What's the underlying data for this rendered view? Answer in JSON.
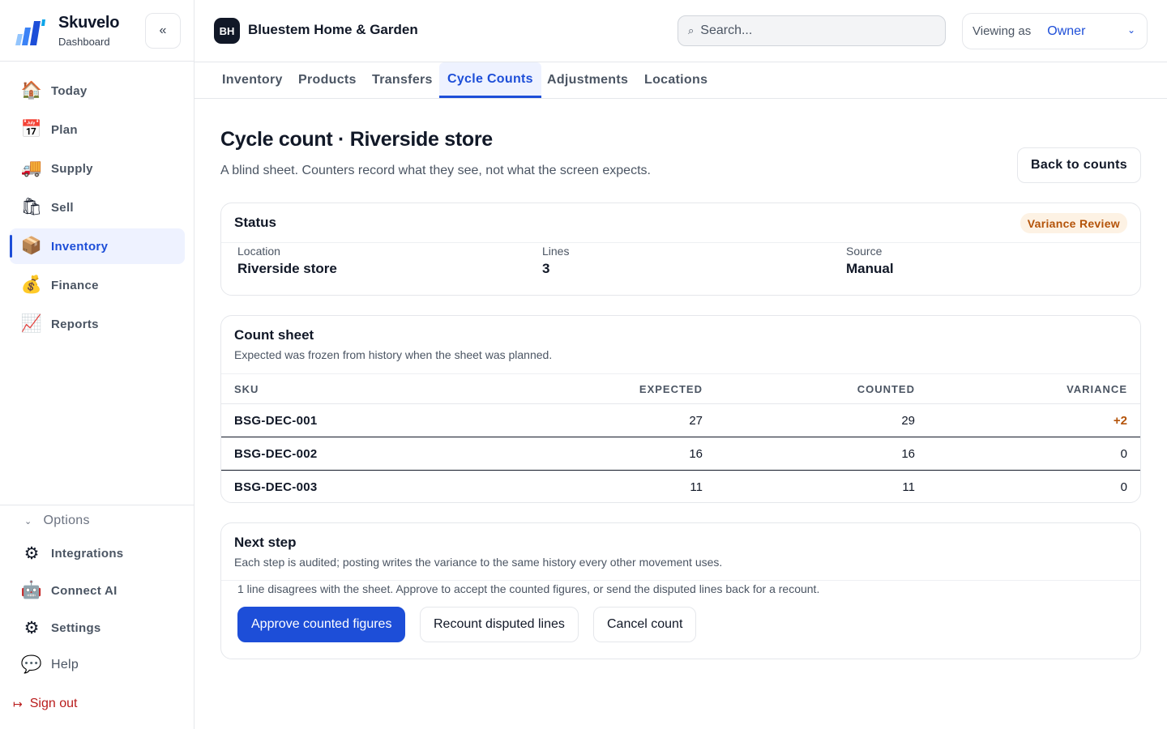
{
  "brand": {
    "name": "Skuvelo",
    "subtitle": "Dashboard",
    "collapse_icon": "«"
  },
  "nav": [
    {
      "icon": "🏠",
      "label": "Today"
    },
    {
      "icon": "📅",
      "label": "Plan"
    },
    {
      "icon": "🚚",
      "label": "Supply"
    },
    {
      "icon": "🛍",
      "label": "Sell"
    },
    {
      "icon": "📦",
      "label": "Inventory",
      "active": true
    },
    {
      "icon": "💰",
      "label": "Finance"
    },
    {
      "icon": "📈",
      "label": "Reports"
    }
  ],
  "options": {
    "label": "Options",
    "chevron": "⌄"
  },
  "nav_secondary": [
    {
      "icon": "⚙",
      "label": "Integrations"
    },
    {
      "icon": "🤖",
      "label": "Connect AI"
    },
    {
      "icon": "⚙",
      "label": "Settings"
    },
    {
      "icon": "💬",
      "label": "Help"
    }
  ],
  "signout": {
    "icon": "↦",
    "label": "Sign out"
  },
  "org": {
    "initials": "BH",
    "name": "Bluestem Home & Garden"
  },
  "search": {
    "placeholder": "Search...",
    "icon": "⌕"
  },
  "viewing": {
    "label": "Viewing as",
    "value": "Owner",
    "chevron": "⌄"
  },
  "tabs": [
    "Inventory",
    "Products",
    "Transfers",
    "Cycle Counts",
    "Adjustments",
    "Locations"
  ],
  "active_tab": "Cycle Counts",
  "page": {
    "title": "Cycle count · Riverside store",
    "subtitle": "A blind sheet. Counters record what they see, not what the screen expects.",
    "back_label": "Back to counts"
  },
  "status": {
    "title": "Status",
    "badge": "Variance Review",
    "location_label": "Location",
    "location_value": "Riverside store",
    "lines_label": "Lines",
    "lines_value": "3",
    "source_label": "Source",
    "source_value": "Manual"
  },
  "sheet": {
    "title": "Count sheet",
    "subtitle": "Expected was frozen from history when the sheet was planned.",
    "columns": [
      "SKU",
      "EXPECTED",
      "COUNTED",
      "VARIANCE"
    ],
    "rows": [
      {
        "sku": "BSG-DEC-001",
        "expected": "27",
        "counted": "29",
        "variance": "+2"
      },
      {
        "sku": "BSG-DEC-002",
        "expected": "16",
        "counted": "16",
        "variance": "0"
      },
      {
        "sku": "BSG-DEC-003",
        "expected": "11",
        "counted": "11",
        "variance": "0"
      }
    ]
  },
  "next": {
    "title": "Next step",
    "subtitle": "Each step is audited; posting writes the variance to the same history every other movement uses.",
    "message": "1 line disagrees with the sheet. Approve to accept the counted figures, or send the disputed lines back for a recount.",
    "approve_label": "Approve counted figures",
    "recount_label": "Recount disputed lines",
    "cancel_label": "Cancel count"
  },
  "colors": {
    "accent": "#1d4ed8",
    "badge_bg": "#fdf2e4",
    "badge_text": "#b45309",
    "danger": "#b91c1c"
  }
}
